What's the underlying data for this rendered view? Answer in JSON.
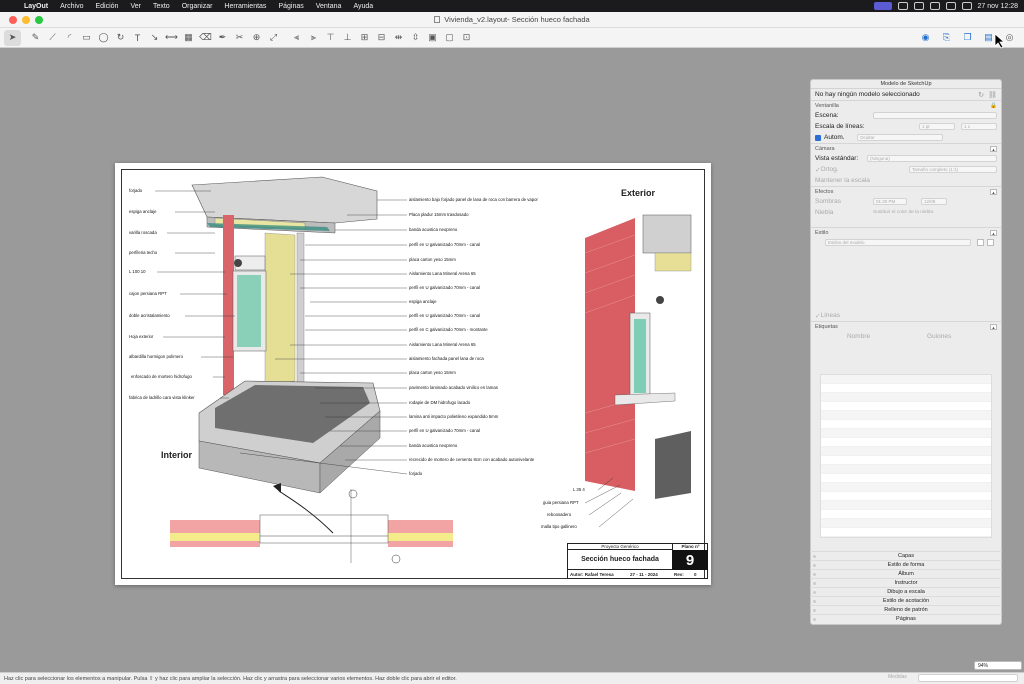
{
  "menubar": {
    "app": "LayOut",
    "items": [
      "Archivo",
      "Edición",
      "Ver",
      "Texto",
      "Organizar",
      "Herramientas",
      "Páginas",
      "Ventana",
      "Ayuda"
    ],
    "clock": "27 nov 12:28"
  },
  "window": {
    "title": "Vivienda_v2.layout- Sección hueco fachada"
  },
  "drawing": {
    "left_labels": [
      "forjado",
      "espiga anclaje",
      "varilla roscada",
      "perfileria techo",
      "L 100 10",
      "cajon persiana RPT",
      "doble acristalamiento",
      "Hoja exterior",
      "albardilla hormigon polimero",
      "enfoscado de mortero hidrofugo",
      "fabrica de ladrillo cara vista klinker"
    ],
    "right_labels": [
      "aislamiento bajo forjado panel de lana de roca con barrera de vapor",
      "Placa pladur 15mm trasdosado",
      "banda acustica neopreno",
      "perfil en U galvanizado 70mm - canal",
      "placa carton yeso 15mm",
      "Aislamiento Lana Mineral Arena 65",
      "perfil en U galvanizado 70mm - canal",
      "espiga anclaje",
      "perfil en U galvanizado 70mm - canal",
      "perfil en C galvanizado 70mm - montante",
      "Aislamiento Lana Mineral Arena 65",
      "aislamiento fachada panel lana de roca",
      "placa carton yeso 15mm",
      "pavimento laminado acabado vinilico en lamas",
      "rodapie de DM hidrofugo lacado",
      "lamina anti impacto polietileno expandido 5mm",
      "perfil en U galvanizado 70mm - canal",
      "banda acustica neopreno",
      "recrecido de mortero de cemento 8cm con acabado autonivelante",
      "forjado"
    ],
    "exterior_labels": [
      "L 35 4",
      "guia persiana RPT",
      "reboosadero",
      "malla tipo gallinero"
    ],
    "label_exterior": "Exterior",
    "label_interior": "Interior"
  },
  "titleblock": {
    "project": "Proyecto Genérico",
    "title": "Sección hueco fachada",
    "plano_label": "Plano nº",
    "number": "9",
    "author": "Autor: Rafael Teresa",
    "date": "27 - 11 - 2024",
    "rev_label": "Rev:",
    "rev_value": "0"
  },
  "tray": {
    "header": "Modelo de SketchUp",
    "no_model": "No hay ningún modelo seleccionado",
    "section_window": "Ventanilla",
    "scene_label": "Escena:",
    "line_scale_label": "Escala de líneas:",
    "line_scale_value": "1 pt",
    "line_scale_mult": "1 x",
    "auto_label": "Autom.",
    "auto_value": "Ocultar",
    "section_camera": "Cámara",
    "std_view_label": "Vista estándar:",
    "std_view_value": "(Ninguna)",
    "ortho_label": "Ortog.",
    "ortho_value": "Tamaño completo (1:1)",
    "preserve_label": "Mantener la escala",
    "section_effects": "Efectos",
    "shadows_label": "Sombras",
    "shadow_time_1": "01:30 PM",
    "shadow_time_2": "12/08",
    "fog_label": "Niebla",
    "fog_value": "Sustituir el color de la niebla",
    "section_style": "Estilo",
    "style_value": "Estilos del modelo",
    "lines_label": "Líneas",
    "section_tags": "Etiquetas",
    "col_name": "Nombre",
    "col_dashes": "Guiones",
    "bottom_panels": [
      "Capas",
      "Estilo de forma",
      "Álbum",
      "Instructor",
      "Dibujo a escala",
      "Estilo de acotación",
      "Relleno de patrón",
      "Páginas"
    ]
  },
  "status": {
    "hint": "Haz clic para seleccionar los elementos a manipular. Pulsa ⇧ y haz clic para ampliar la selección. Haz clic y arrastra para seleccionar varios elementos. Haz doble clic para abrir el editor.",
    "measure_label": "Medidas",
    "zoom": "94%"
  }
}
